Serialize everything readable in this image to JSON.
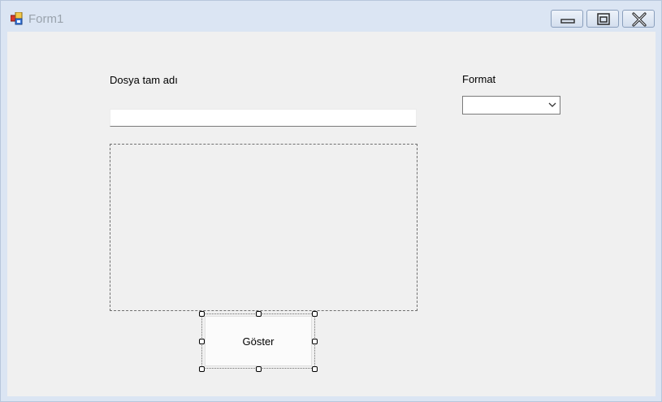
{
  "window": {
    "title": "Form1",
    "icons": {
      "app": "form-app-icon",
      "minimize": "minimize-icon",
      "maximize": "maximize-icon",
      "close": "close-icon"
    }
  },
  "form": {
    "filename_label": "Dosya tam adı",
    "filename_value": "",
    "format_label": "Format",
    "format_selected": "",
    "show_button_label": "Göster"
  }
}
